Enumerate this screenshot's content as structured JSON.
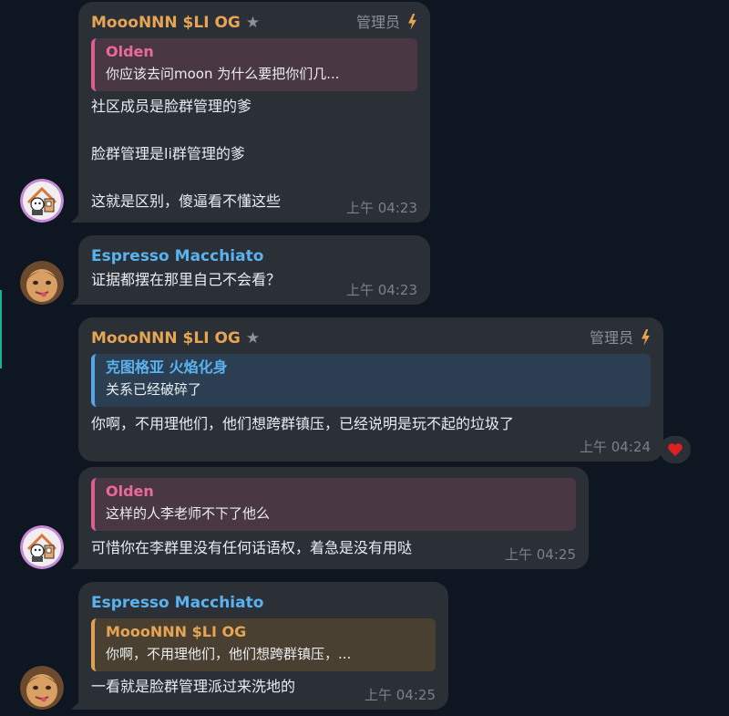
{
  "messages": [
    {
      "sender": "MoooNNN $LI OG",
      "role": "管理员",
      "quote": {
        "name": "Olden",
        "text": "你应该去问moon 为什么要把你们几..."
      },
      "lines": [
        "社区成员是脸群管理的爹",
        "",
        "脸群管理是li群管理的爹",
        "",
        "这就是区别，傻逼看不懂这些"
      ],
      "time": "上午 04:23"
    },
    {
      "sender": "Espresso Macchiato",
      "lines": [
        "证据都摆在那里自己不会看？"
      ],
      "time": "上午 04:23"
    },
    {
      "sender": "MoooNNN $LI OG",
      "role": "管理员",
      "quote": {
        "name": "克图格亚 火焰化身",
        "text": "关系已经破碎了"
      },
      "lines": [
        "你啊，不用理他们，他们想跨群镇压，已经说明是玩不起的垃圾了"
      ],
      "time": "上午 04:24",
      "reaction": "heart"
    },
    {
      "quote": {
        "name": "Olden",
        "text": "这样的人李老师不下了他么"
      },
      "lines": [
        "可惜你在李群里没有任何话语权，着急是没有用哒"
      ],
      "time": "上午 04:25"
    },
    {
      "sender": "Espresso Macchiato",
      "quote": {
        "name": "MoooNNN $LI OG",
        "text": "你啊，不用理他们，他们想跨群镇压，..."
      },
      "lines": [
        "一看就是脸群管理派过来洗地的"
      ],
      "time": "上午 04:25"
    }
  ],
  "icons": {
    "star": "star-icon",
    "bolt": "bolt-icon",
    "reaction": "heart-icon",
    "avatar_a": "cartoon-house-avatar",
    "avatar_b": "face-avatar"
  },
  "colors": {
    "background": "#0e1621",
    "bubble": "#2b2f36",
    "admin_name": "#e7a553",
    "member_name": "#5ab3f0",
    "quote_pink": "#d85f8f",
    "heart": "#e02020"
  }
}
